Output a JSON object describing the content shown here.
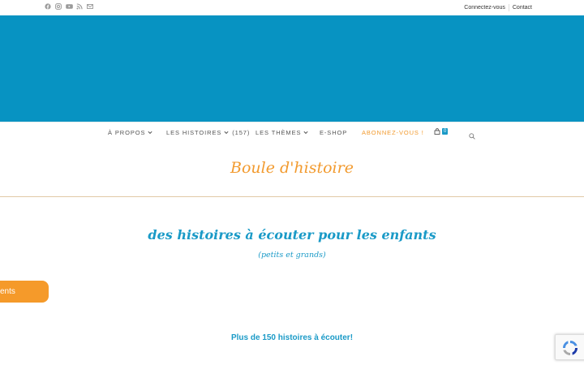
{
  "topbar": {
    "social_icons": [
      "facebook-icon",
      "instagram-icon",
      "youtube-icon",
      "rss-icon",
      "email-icon"
    ],
    "links": [
      "Connectez-vous",
      "Contact"
    ]
  },
  "colors": {
    "banner": "#0793c2",
    "accent_orange": "#f29a2e",
    "accent_blue": "#1a9ac7"
  },
  "nav": {
    "items": [
      {
        "label": "À PROPOS",
        "has_dropdown": true
      },
      {
        "label": "LES HISTOIRES",
        "has_dropdown": true,
        "count": "(157)"
      },
      {
        "label": "LES THÈMES",
        "has_dropdown": true
      },
      {
        "label": "E-SHOP",
        "has_dropdown": false
      },
      {
        "label": "ABONNEZ-VOUS !",
        "has_dropdown": false
      }
    ],
    "cart_count": "0"
  },
  "page": {
    "title": "Boule d'histoire",
    "subtitle": "des histoires à écouter pour les enfants",
    "subsubtitle": "(petits et grands)",
    "side_button": "ents",
    "highlight": "Plus de 150 histoires à écouter!"
  }
}
